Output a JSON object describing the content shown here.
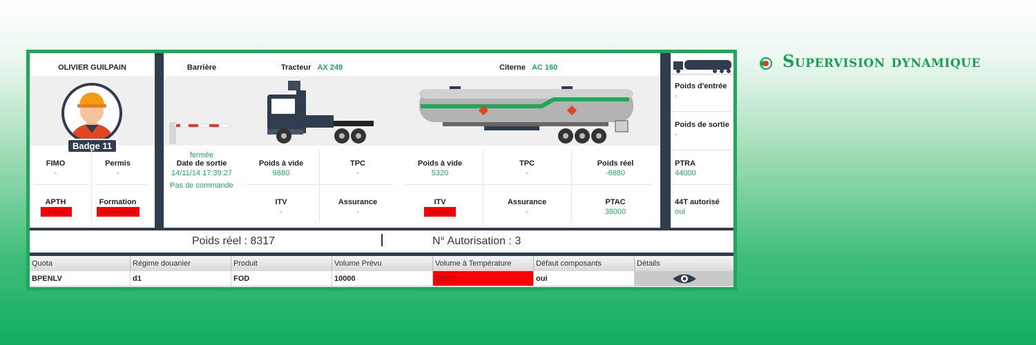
{
  "brand": {
    "title": "Supervision dynamique"
  },
  "driver": {
    "name": "OLIVIER GUILPAIN",
    "badge": "Badge 11",
    "fields": [
      {
        "label": "FIMO",
        "value": "-"
      },
      {
        "label": "Permis",
        "value": "-"
      },
      {
        "label": "APTH",
        "value": "17/09/14"
      },
      {
        "label": "Formation",
        "value": "non réalisée"
      }
    ]
  },
  "barrier": {
    "title": "Barrière",
    "state": "fermée",
    "exit_label": "Date de sortie",
    "exit_value": "14/11/14 17:39:27",
    "command": "Pas de commande"
  },
  "tractor": {
    "label": "Tracteur",
    "id": "AX 249",
    "fields": [
      {
        "label": "Poids à vide",
        "value": "6880"
      },
      {
        "label": "TPC",
        "value": "-"
      },
      {
        "label": "ITV",
        "value": "-"
      },
      {
        "label": "Assurance",
        "value": "-"
      }
    ]
  },
  "tank": {
    "label": "Citerne",
    "id": "AC 160",
    "fields": [
      {
        "label": "Poids à vide",
        "value": "5320"
      },
      {
        "label": "TPC",
        "value": "-"
      },
      {
        "label": "Poids réel",
        "value": "-6880"
      },
      {
        "label": "ITV",
        "value": "01/09/14"
      },
      {
        "label": "Assurance",
        "value": "-"
      },
      {
        "label": "PTAC",
        "value": "38000"
      }
    ]
  },
  "weights": {
    "fields": [
      {
        "label": "Poids d'entrée",
        "value": "-"
      },
      {
        "label": "Poids de sortie",
        "value": "-"
      },
      {
        "label": "PTRA",
        "value": "44000"
      },
      {
        "label": "44T autorisé",
        "value": "oui"
      }
    ]
  },
  "summary": {
    "weight": "Poids réel : 8317",
    "authorization": "N° Autorisation : 3"
  },
  "table": {
    "headers": [
      "Quota",
      "Régime douanier",
      "Produit",
      "Volume Prévu",
      "Volume à Température",
      "Défaut composants",
      "Détails"
    ],
    "row": [
      "BPENLV",
      "d1",
      "FOD",
      "10000",
      "23000",
      "oui",
      ""
    ]
  },
  "colors": {
    "accent": "#1fa85a",
    "dark": "#2f3d4e",
    "alert": "#ff0000"
  }
}
